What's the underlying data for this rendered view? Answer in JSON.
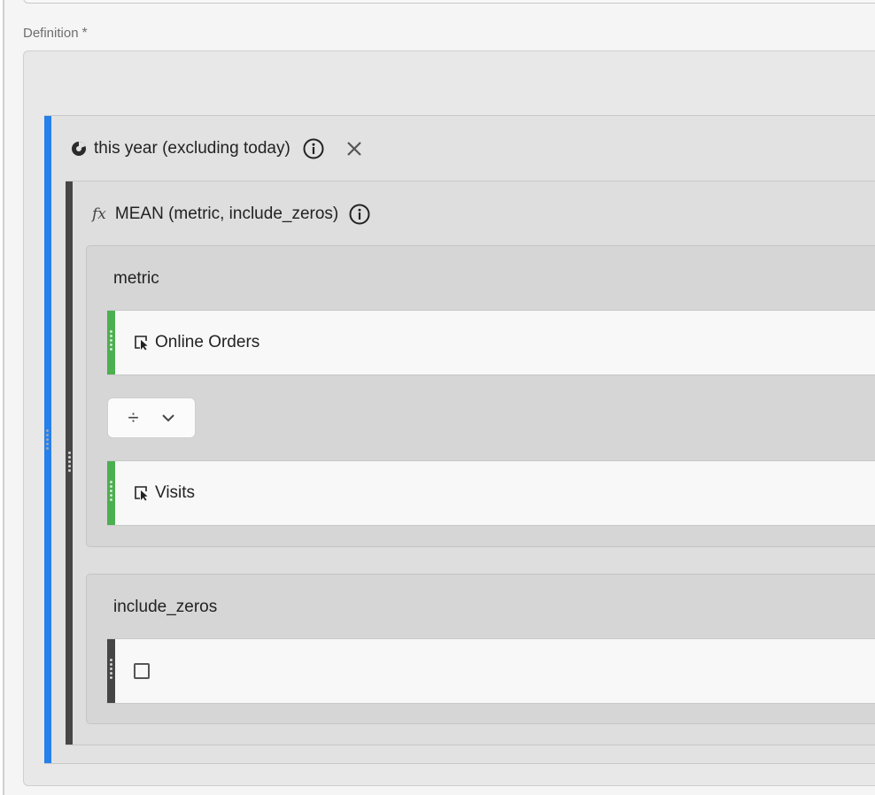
{
  "definition": {
    "label": "Definition",
    "required_marker": "*"
  },
  "segment": {
    "title": "this year (excluding today)",
    "accent_color": "#2680eb",
    "icons": {
      "type": "segment-icon",
      "info": "info-icon",
      "remove": "close-icon"
    }
  },
  "function": {
    "icon_text": "fx",
    "title": "MEAN (metric, include_zeros)",
    "accent_color": "#464646",
    "parameters": {
      "metric": {
        "label": "metric",
        "items": [
          {
            "name": "Online Orders",
            "icon": "metric-icon",
            "accent_color": "#4caf50"
          },
          {
            "name": "Visits",
            "icon": "metric-icon",
            "accent_color": "#4caf50"
          }
        ],
        "operator": {
          "symbol": "÷",
          "icon": "chevron-down-icon"
        }
      },
      "include_zeros": {
        "label": "include_zeros",
        "checked": false,
        "accent_color": "#464646"
      }
    }
  }
}
